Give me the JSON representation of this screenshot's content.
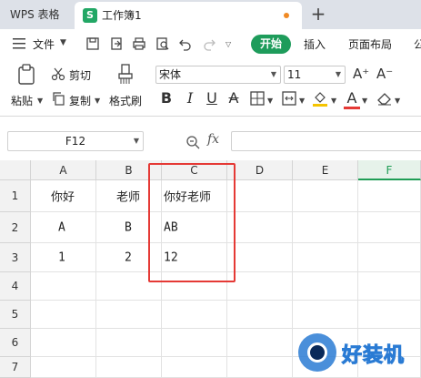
{
  "app": {
    "brand": "WPS 表格"
  },
  "tab": {
    "icon_letter": "S",
    "title": "工作簿1",
    "new_tab": "+"
  },
  "menu": {
    "file": "文件",
    "tabs": [
      "开始",
      "插入",
      "页面布局",
      "公"
    ]
  },
  "toolbar": {
    "paste": "粘贴",
    "cut": "剪切",
    "copy": "复制",
    "format_painter": "格式刷",
    "font_name": "宋体",
    "font_size": "11",
    "grow": "A⁺",
    "shrink": "A⁻",
    "bold": "B",
    "italic": "I",
    "underline": "U",
    "strike": "A",
    "font_color_letter": "A",
    "accent_color": "#1e9c5b",
    "fill_color": "#f5c400",
    "font_color": "#e53935"
  },
  "formula_bar": {
    "name_box": "F12",
    "fx": "fx",
    "value": ""
  },
  "sheet": {
    "columns": [
      "A",
      "B",
      "C",
      "D",
      "E",
      "F"
    ],
    "selected_column": "F",
    "rows": [
      "1",
      "2",
      "3",
      "4",
      "5",
      "6",
      "7"
    ],
    "cells": [
      [
        "你好",
        "老师",
        "你好老师"
      ],
      [
        "A",
        "B",
        "AB"
      ],
      [
        "1",
        "2",
        "12"
      ]
    ]
  },
  "watermark": {
    "text": "好装机"
  }
}
